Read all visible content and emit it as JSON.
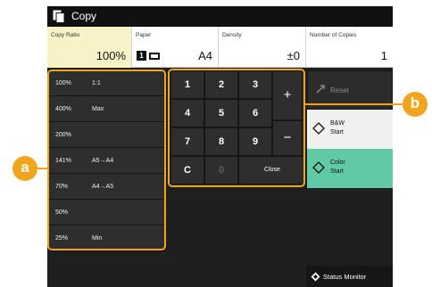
{
  "colors": {
    "accent": "#f1a51e",
    "selected_cell": "#f8f3c6",
    "color_start": "#62c9a6",
    "bw_start": "#f0f0f0",
    "panel": "#2e2e2e"
  },
  "titlebar": {
    "title": "Copy",
    "icon": "copy-icon"
  },
  "status": {
    "copy_ratio": {
      "label": "Copy Ratio",
      "value": "100%"
    },
    "paper": {
      "label": "Paper",
      "tray": "1",
      "value": "A4"
    },
    "density": {
      "label": "Density",
      "value": "±0"
    },
    "copies": {
      "label": "Number of Copies",
      "value": "1"
    }
  },
  "ratios": [
    {
      "pct": "100%",
      "desc": "1:1"
    },
    {
      "pct": "400%",
      "desc": "Max"
    },
    {
      "pct": "200%",
      "desc": ""
    },
    {
      "pct": "141%",
      "desc": "A5→A4"
    },
    {
      "pct": "70%",
      "desc": "A4→A5"
    },
    {
      "pct": "50%",
      "desc": ""
    },
    {
      "pct": "25%",
      "desc": "Min"
    }
  ],
  "keypad": {
    "keys": [
      "1",
      "2",
      "3",
      "4",
      "5",
      "6",
      "7",
      "8",
      "9"
    ],
    "clear": "C",
    "zero": "0",
    "close": "Close",
    "plus": "+",
    "minus": "−"
  },
  "buttons": {
    "reset": "Reset",
    "bw_start_line1": "B&W",
    "bw_start_line2": "Start",
    "color_start_line1": "Color",
    "color_start_line2": "Start"
  },
  "status_monitor": "Status Monitor",
  "callouts": {
    "a": "a",
    "b": "b"
  }
}
